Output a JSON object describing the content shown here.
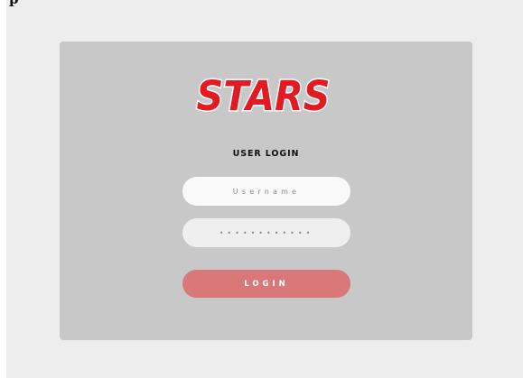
{
  "top_text": "p",
  "logo": {
    "text": "STARS",
    "color": "#e21b23",
    "outline_color": "#ffffff"
  },
  "login": {
    "title": "USER LOGIN",
    "username_placeholder": "Username",
    "password_placeholder": "••••••••••••",
    "button_label": "LOGIN",
    "button_color": "#d97878"
  }
}
